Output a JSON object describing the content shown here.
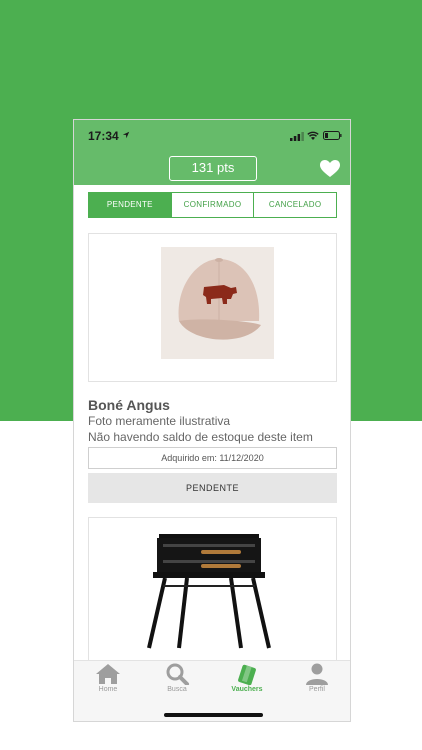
{
  "status_bar": {
    "time": "17:34"
  },
  "header": {
    "points": "131 pts",
    "icon": "heart-icon"
  },
  "tabs": [
    {
      "label": "PENDENTE",
      "active": true
    },
    {
      "label": "CONFIRMADO",
      "active": false
    },
    {
      "label": "CANCELADO",
      "active": false
    }
  ],
  "vouchers": [
    {
      "title": "Boné Angus",
      "line1": "Foto meramente ilustrativa",
      "line2": "Não havendo saldo de estoque deste item",
      "acquired": "Adquirido em: 11/12/2020",
      "status": "PENDENTE"
    }
  ],
  "tabbar": {
    "items": [
      {
        "label": "Home",
        "icon": "home-icon"
      },
      {
        "label": "Busca",
        "icon": "search-icon"
      },
      {
        "label": "Vauchers",
        "icon": "voucher-icon",
        "active": true
      },
      {
        "label": "Perfil",
        "icon": "profile-icon"
      }
    ]
  },
  "colors": {
    "primary": "#4caf50",
    "header": "#66bb6a",
    "inactive": "#999999"
  }
}
